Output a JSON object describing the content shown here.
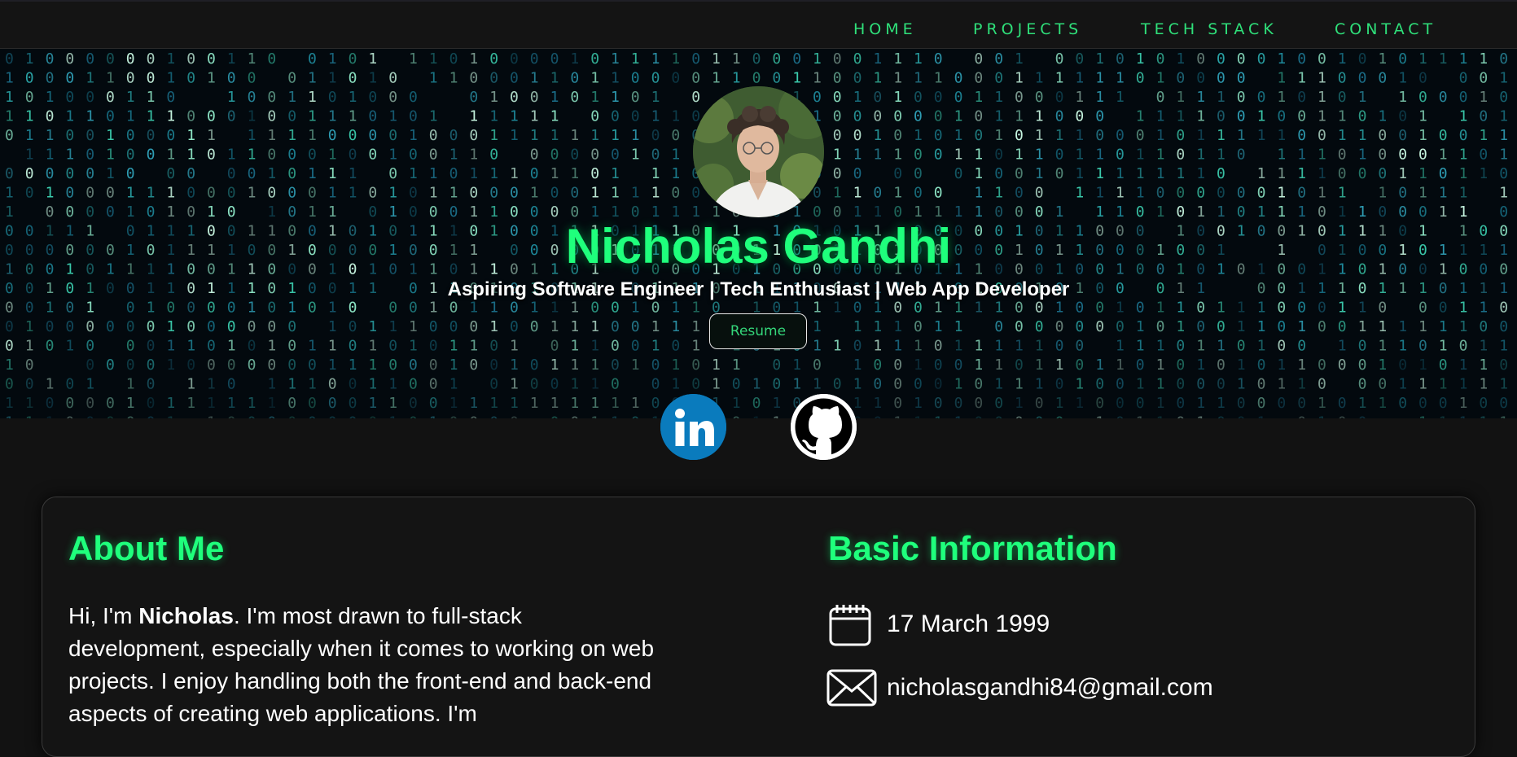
{
  "nav": {
    "links": [
      "HOME",
      "PROJECTS",
      "TECH STACK",
      "CONTACT"
    ]
  },
  "hero": {
    "name": "Nicholas Gandhi",
    "tagline": "Aspiring Software Engineer | Tech Enthusiast | Web App Developer",
    "resume_label": "Resume",
    "social": [
      {
        "name": "LinkedIn",
        "icon": "linkedin-icon"
      },
      {
        "name": "GitHub",
        "icon": "github-icon"
      }
    ]
  },
  "about": {
    "title": "About Me",
    "intro": "Hi, I'm ",
    "name_bold": "Nicholas",
    "text": ". I'm most drawn to full-stack development, especially when it comes to working on web projects. I enjoy handling both the front-end and back-end aspects of creating web applications. I'm"
  },
  "basic_info": {
    "title": "Basic Information",
    "birthday": "17 March 1999",
    "email": "nicholasgandhi84@gmail.com"
  },
  "colors": {
    "accent": "#1fff7c",
    "nav_link": "#2fe07a",
    "background": "#121212",
    "linkedin": "#0a7bbd"
  }
}
